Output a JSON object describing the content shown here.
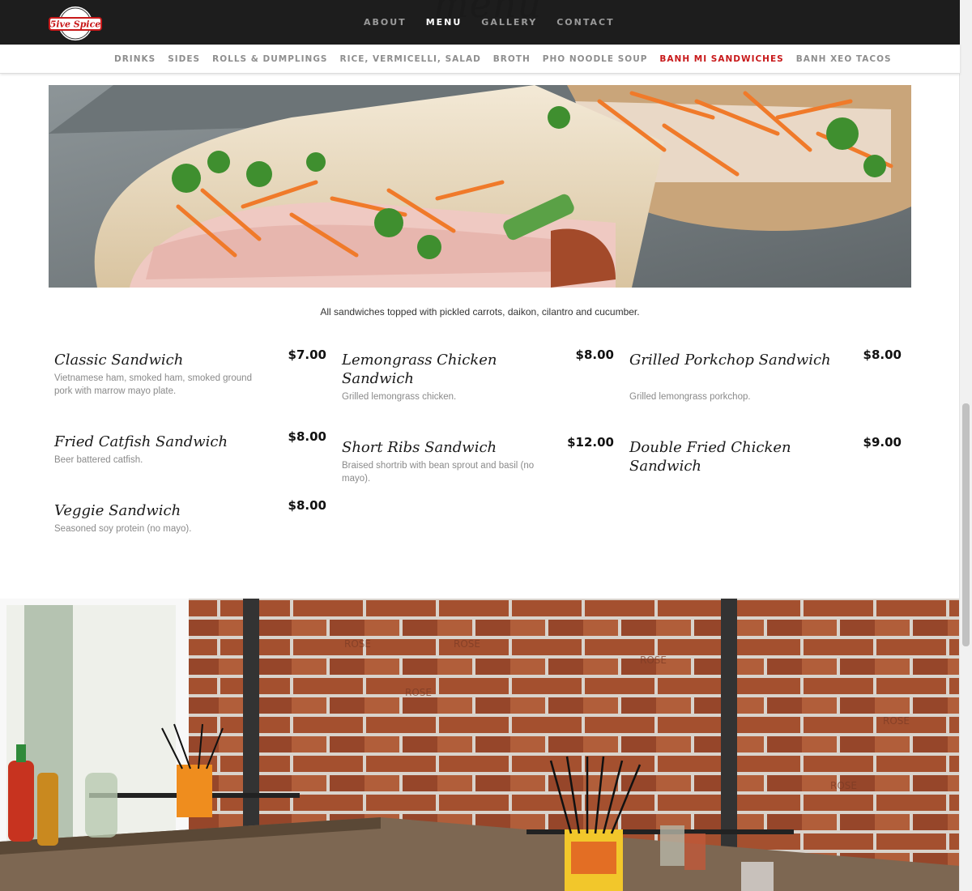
{
  "brand": {
    "logo_text": "5ive Spice"
  },
  "page_title": "menu",
  "top_nav": [
    {
      "label": "ABOUT",
      "active": false
    },
    {
      "label": "MENU",
      "active": true
    },
    {
      "label": "GALLERY",
      "active": false
    },
    {
      "label": "CONTACT",
      "active": false
    }
  ],
  "sub_nav": [
    {
      "label": "DRINKS",
      "active": false
    },
    {
      "label": "SIDES",
      "active": false
    },
    {
      "label": "ROLLS & DUMPLINGS",
      "active": false
    },
    {
      "label": "RICE, VERMICELLI, SALAD",
      "active": false
    },
    {
      "label": "BROTH",
      "active": false
    },
    {
      "label": "PHO NOODLE SOUP",
      "active": false
    },
    {
      "label": "BANH MI SANDWICHES",
      "active": true
    },
    {
      "label": "BANH XEO TACOS",
      "active": false
    }
  ],
  "section_note": "All sandwiches topped with pickled carrots, daikon, cilantro and cucumber.",
  "items": [
    {
      "name": "Classic Sandwich",
      "price": "$7.00",
      "desc": "Vietnamese ham, smoked ham, smoked ground pork with marrow mayo plate."
    },
    {
      "name": "Lemongrass Chicken Sandwich",
      "price": "$8.00",
      "desc": "Grilled lemongrass chicken."
    },
    {
      "name": "Grilled Porkchop Sandwich",
      "price": "$8.00",
      "desc": "Grilled lemongrass porkchop."
    },
    {
      "name": "Fried Catfish Sandwich",
      "price": "$8.00",
      "desc": "Beer battered catfish."
    },
    {
      "name": "Short Ribs Sandwich",
      "price": "$12.00",
      "desc": "Braised shortrib with bean sprout and basil (no mayo)."
    },
    {
      "name": "Double Fried Chicken Sandwich",
      "price": "$9.00",
      "desc": ""
    },
    {
      "name": "Veggie Sandwich",
      "price": "$8.00",
      "desc": "Seasoned soy protein (no mayo)."
    }
  ],
  "colors": {
    "accent": "#c8191a",
    "topbar": "#1d1d1d"
  }
}
